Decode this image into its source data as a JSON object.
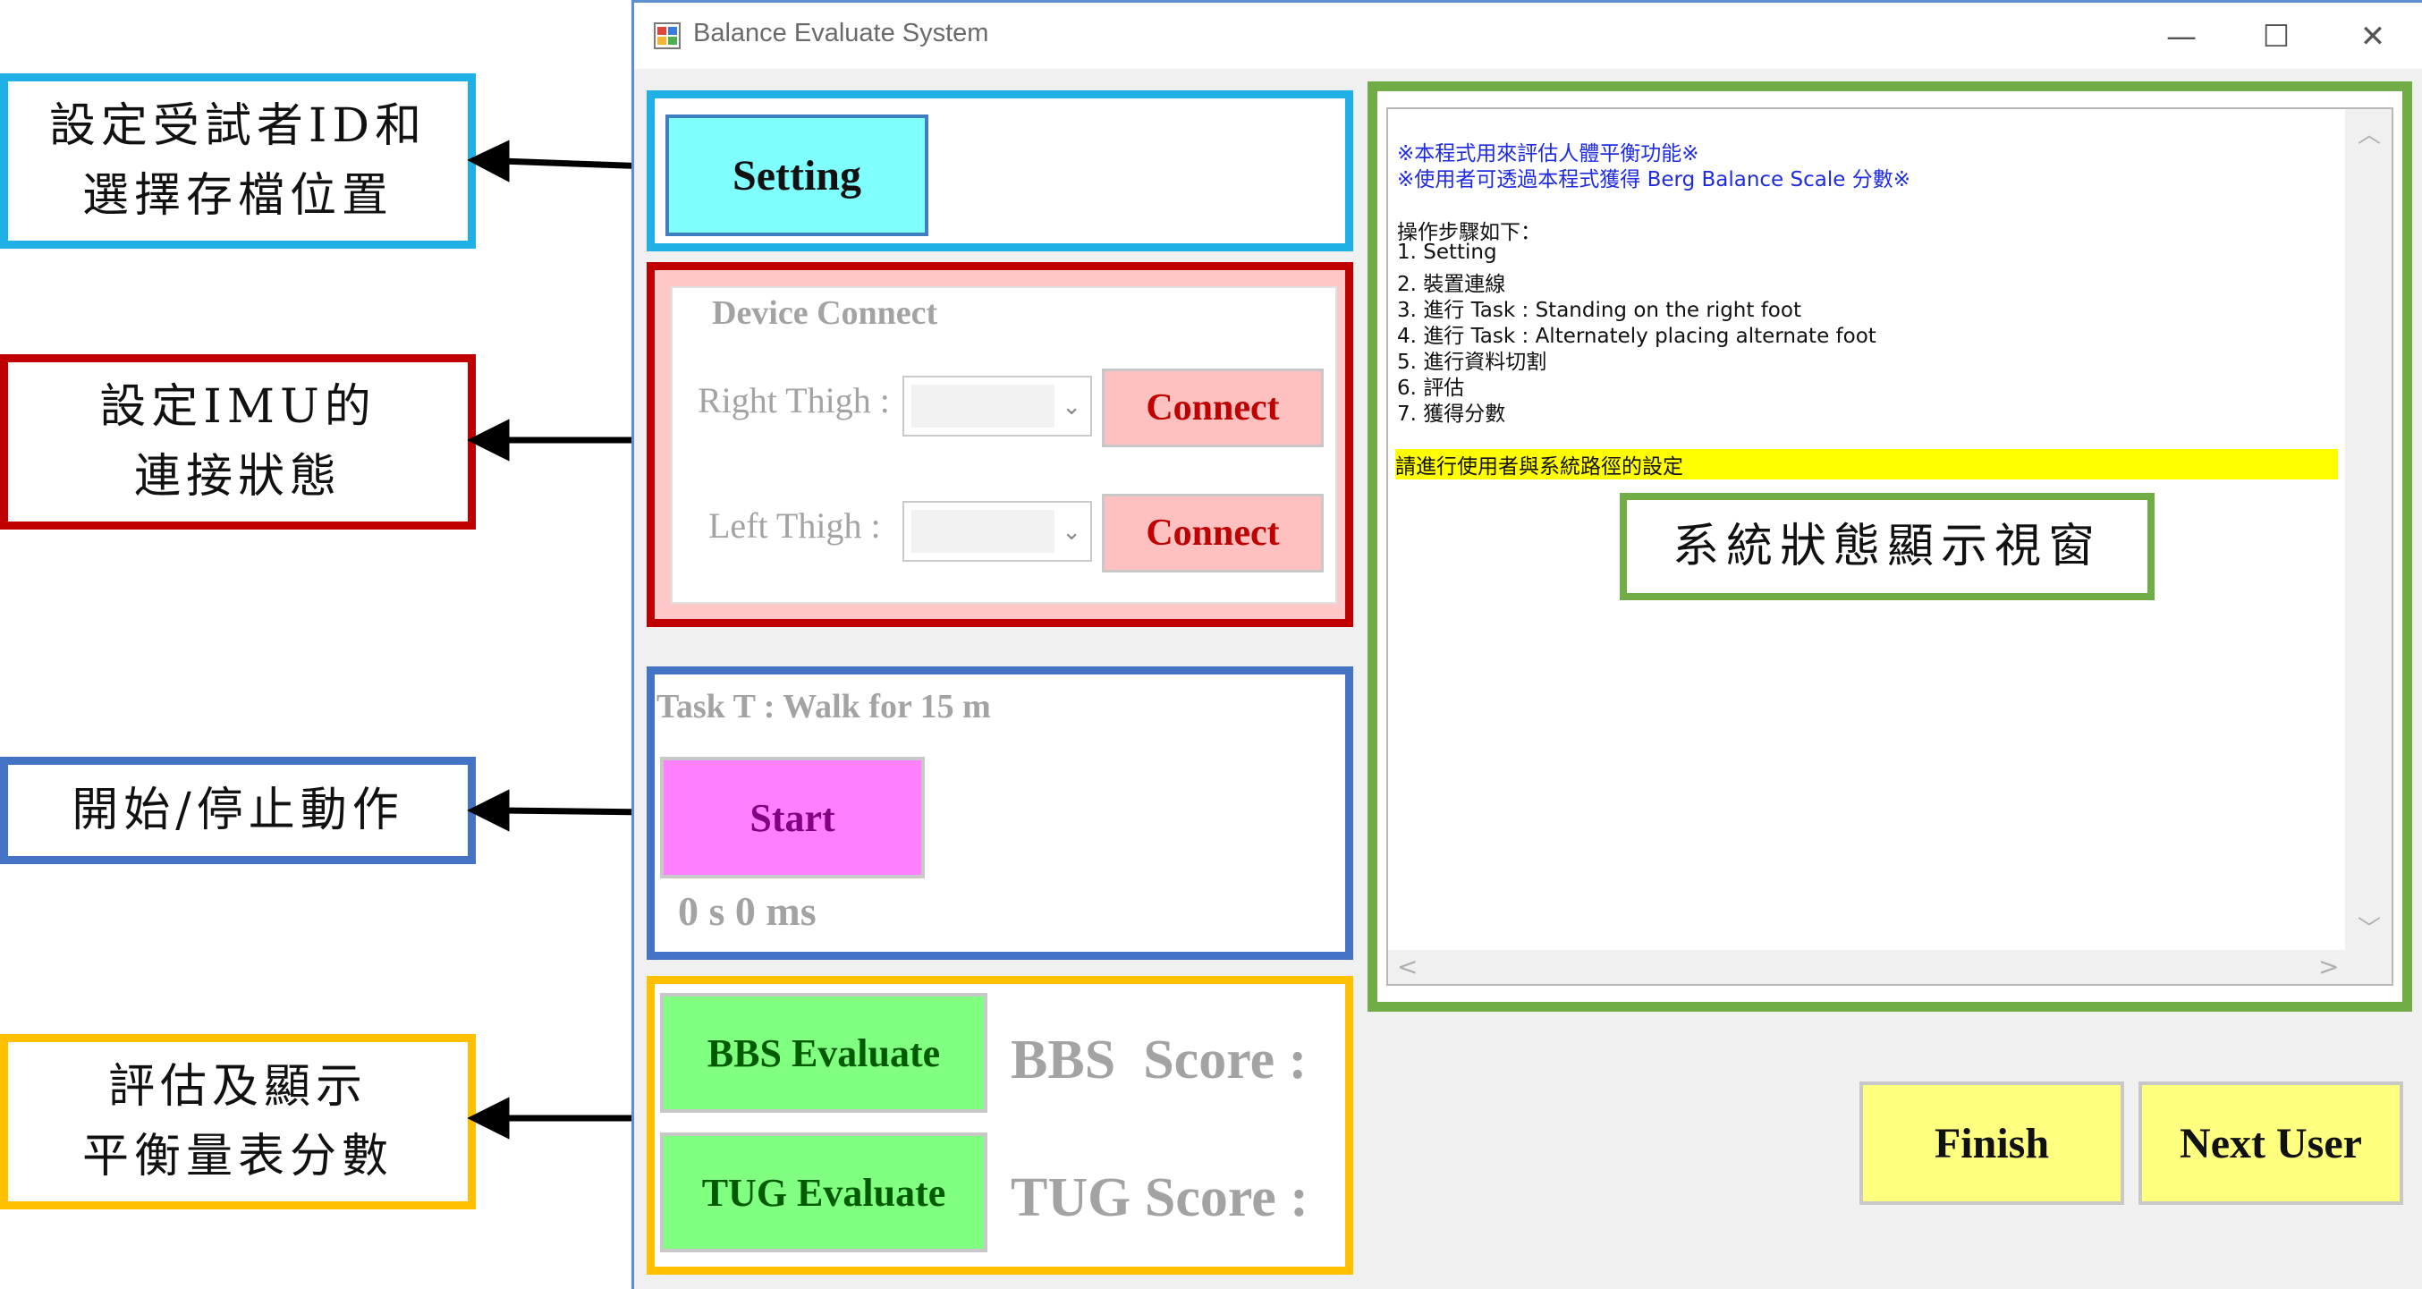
{
  "window": {
    "title": "Balance Evaluate System",
    "minimize_glyph": "—",
    "maximize_glyph": "☐",
    "close_glyph": "✕"
  },
  "setting": {
    "button_label": "Setting"
  },
  "device_connect": {
    "group_title": "Device Connect",
    "right_thigh_label": "Right Thigh :",
    "left_thigh_label": "Left Thigh :",
    "connect_label": "Connect",
    "dropdown_arrow": "⌄"
  },
  "task": {
    "title": "Task T : Walk for 15 m",
    "start_label": "Start",
    "timer": "0 s 0 ms"
  },
  "evaluate": {
    "bbs_button": "BBS Evaluate",
    "bbs_score_label": "BBS  Score :",
    "tug_button": "TUG Evaluate",
    "tug_score_label": "TUG Score :"
  },
  "footer": {
    "finish_label": "Finish",
    "next_user_label": "Next User"
  },
  "log": {
    "line1": "※本程式用來評估人體平衡功能※",
    "line2": "※使用者可透過本程式獲得 Berg Balance Scale 分數※",
    "steps_header": "操作步驟如下：",
    "steps": [
      "1. Setting",
      "2. 裝置連線",
      "3. 進行 Task : Standing on the right foot",
      "4. 進行 Task : Alternately placing alternate foot",
      "5. 進行資料切割",
      "6. 評估",
      "7. 獲得分數"
    ],
    "highlight": "請進行使用者與系統路徑的設定",
    "scroll_up": "︿",
    "scroll_down": "﹀",
    "scroll_left": "<",
    "scroll_right": ">"
  },
  "annotations": {
    "setting_lines": [
      "設定受試者ID和",
      "選擇存檔位置"
    ],
    "imu_lines": [
      "設定IMU的",
      "連接狀態"
    ],
    "action_lines": [
      "開始/停止動作"
    ],
    "score_lines": [
      "評估及顯示",
      "平衡量表分數"
    ],
    "status_window": "系統狀態顯示視窗"
  },
  "colors": {
    "cyan_frame": "#1fb0e6",
    "red_frame": "#c00000",
    "blue_frame": "#4472c4",
    "orange_frame": "#ffc000",
    "green_frame": "#70ad47",
    "setting_btn": "#80ffff",
    "connect_btn": "#ffc0c0",
    "start_btn": "#ff80ff",
    "evaluate_btn": "#80ff80",
    "footer_btn": "#ffff80"
  }
}
